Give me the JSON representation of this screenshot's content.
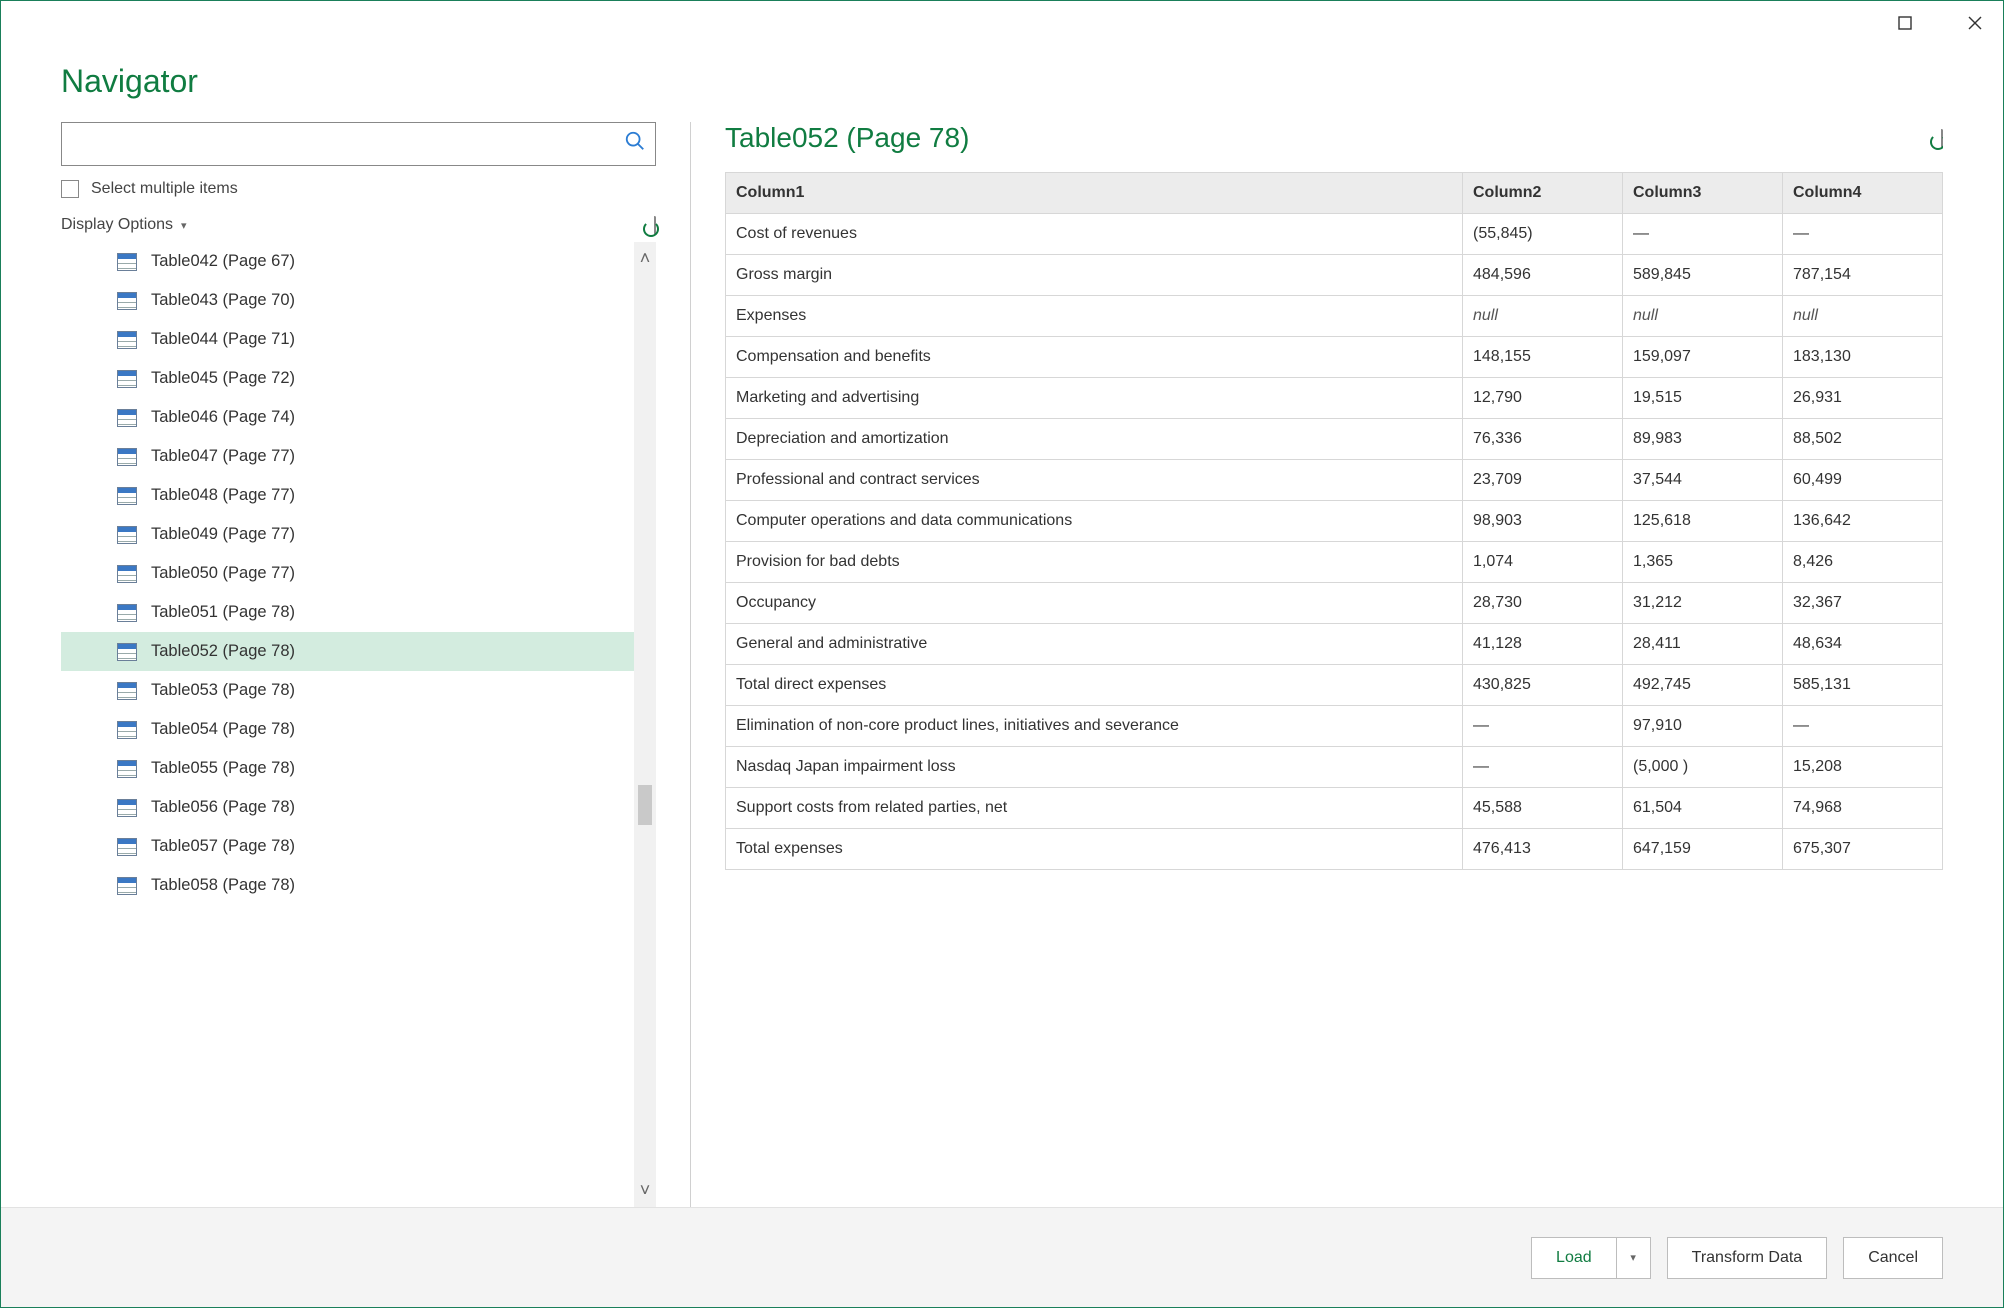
{
  "window": {
    "title": "Navigator"
  },
  "search": {
    "placeholder": ""
  },
  "select_multiple_label": "Select multiple items",
  "display_options_label": "Display Options",
  "tree": {
    "items": [
      {
        "label": "Table042 (Page 67)",
        "selected": false
      },
      {
        "label": "Table043 (Page 70)",
        "selected": false
      },
      {
        "label": "Table044 (Page 71)",
        "selected": false
      },
      {
        "label": "Table045 (Page 72)",
        "selected": false
      },
      {
        "label": "Table046 (Page 74)",
        "selected": false
      },
      {
        "label": "Table047 (Page 77)",
        "selected": false
      },
      {
        "label": "Table048 (Page 77)",
        "selected": false
      },
      {
        "label": "Table049 (Page 77)",
        "selected": false
      },
      {
        "label": "Table050 (Page 77)",
        "selected": false
      },
      {
        "label": "Table051 (Page 78)",
        "selected": false
      },
      {
        "label": "Table052 (Page 78)",
        "selected": true
      },
      {
        "label": "Table053 (Page 78)",
        "selected": false
      },
      {
        "label": "Table054 (Page 78)",
        "selected": false
      },
      {
        "label": "Table055 (Page 78)",
        "selected": false
      },
      {
        "label": "Table056 (Page 78)",
        "selected": false
      },
      {
        "label": "Table057 (Page 78)",
        "selected": false
      },
      {
        "label": "Table058 (Page 78)",
        "selected": false
      }
    ]
  },
  "preview": {
    "title": "Table052 (Page 78)",
    "columns": [
      "Column1",
      "Column2",
      "Column3",
      "Column4"
    ],
    "rows": [
      [
        "Cost of revenues",
        "(55,845)",
        "—",
        "—"
      ],
      [
        "Gross margin",
        "484,596",
        "589,845",
        "787,154"
      ],
      [
        "Expenses",
        "null",
        "null",
        "null"
      ],
      [
        "Compensation and benefits",
        "148,155",
        "159,097",
        "183,130"
      ],
      [
        "Marketing and advertising",
        "12,790",
        "19,515",
        "26,931"
      ],
      [
        "Depreciation and amortization",
        "76,336",
        "89,983",
        "88,502"
      ],
      [
        "Professional and contract services",
        "23,709",
        "37,544",
        "60,499"
      ],
      [
        "Computer operations and data communications",
        "98,903",
        "125,618",
        "136,642"
      ],
      [
        "Provision for bad debts",
        "1,074",
        "1,365",
        "8,426"
      ],
      [
        "Occupancy",
        "28,730",
        "31,212",
        "32,367"
      ],
      [
        "General and administrative",
        "41,128",
        "28,411",
        "48,634"
      ],
      [
        "Total direct expenses",
        "430,825",
        "492,745",
        "585,131"
      ],
      [
        "Elimination of non-core product lines, initiatives and severance",
        "—",
        "97,910",
        "—"
      ],
      [
        "Nasdaq Japan impairment loss",
        "—",
        "(5,000 )",
        "15,208"
      ],
      [
        "Support costs from related parties, net",
        "45,588",
        "61,504",
        "74,968"
      ],
      [
        "Total expenses",
        "476,413",
        "647,159",
        "675,307"
      ]
    ],
    "null_text": "null"
  },
  "footer": {
    "load_label": "Load",
    "transform_label": "Transform Data",
    "cancel_label": "Cancel"
  }
}
